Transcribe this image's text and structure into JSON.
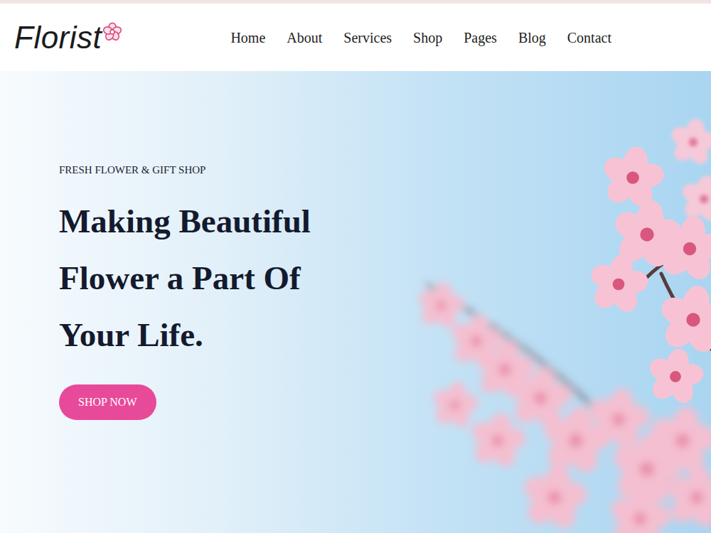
{
  "logo": {
    "text": "Florist"
  },
  "nav": {
    "items": [
      "Home",
      "About",
      "Services",
      "Shop",
      "Pages",
      "Blog",
      "Contact"
    ]
  },
  "hero": {
    "eyebrow": "FRESH FLOWER & GIFT SHOP",
    "title": "Making Beautiful Flower a Part Of Your Life.",
    "button": "SHOP NOW"
  }
}
